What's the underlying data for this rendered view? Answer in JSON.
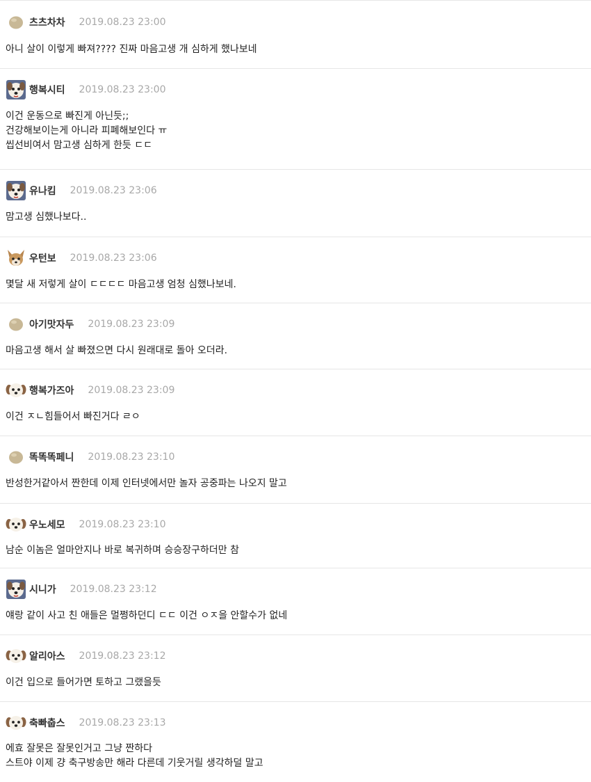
{
  "comments": [
    {
      "nickname": "츠츠차차",
      "date": "2019.08.23 23:00",
      "avatar": "blob-icon",
      "lines": [
        "아니 살이 이렇게 빠져???? 진짜 마음고생 개 심하게 했나보네"
      ]
    },
    {
      "nickname": "행복시티",
      "date": "2019.08.23 23:00",
      "avatar": "dog-face-icon",
      "lines": [
        "이건 운동으로 빠진게 아닌듯;;",
        "건강해보이는게 아니라 피폐해보인다 ㅠ",
        "씹선비여서 맘고생 심하게 한듯 ㄷㄷ"
      ]
    },
    {
      "nickname": "유나킴",
      "date": "2019.08.23 23:06",
      "avatar": "dog-face-icon",
      "lines": [
        "맘고생 심했나보다.."
      ]
    },
    {
      "nickname": "우턴보",
      "date": "2019.08.23 23:06",
      "avatar": "fox-face-icon",
      "lines": [
        "몇달 새 저렇게 살이 ㄷㄷㄷㄷ 마음고생 엄청 심했나보네."
      ]
    },
    {
      "nickname": "아기맛자두",
      "date": "2019.08.23 23:09",
      "avatar": "blob-icon",
      "lines": [
        "마음고생 해서 살 빠졌으면 다시 원래대로 돌아 오더라."
      ]
    },
    {
      "nickname": "행복가즈아",
      "date": "2019.08.23 23:09",
      "avatar": "puppy-icon",
      "lines": [
        "이건 ㅈㄴ힘들어서 빠진거다 ㄹㅇ"
      ]
    },
    {
      "nickname": "똑똑똑페니",
      "date": "2019.08.23 23:10",
      "avatar": "blob-icon",
      "lines": [
        "반성한거같아서 짠한데 이제 인터넷에서만 놀자 공중파는 나오지 말고"
      ]
    },
    {
      "nickname": "우노세모",
      "date": "2019.08.23 23:10",
      "avatar": "puppy-icon",
      "lines": [
        "남순 이놈은 얼마안지나 바로 복귀하며 승승장구하더만 참"
      ]
    },
    {
      "nickname": "시니가",
      "date": "2019.08.23 23:12",
      "avatar": "dog-face-icon",
      "lines": [
        "얘랑 같이 사고 친 애들은 멀쩡하던디 ㄷㄷ 이건 ㅇㅈ을 안할수가 없네"
      ]
    },
    {
      "nickname": "알리아스",
      "date": "2019.08.23 23:12",
      "avatar": "puppy-icon",
      "lines": [
        "이건 입으로 들어가면 토하고 그랬을듯"
      ]
    },
    {
      "nickname": "축빠춥스",
      "date": "2019.08.23 23:13",
      "avatar": "puppy-icon",
      "lines": [
        "에효 잘못은 잘못인거고 그냥 짠하다",
        "스트야 이제 걍 축구방송만 해라 다른데 기웃거릴 생각하덜 말고"
      ]
    }
  ]
}
